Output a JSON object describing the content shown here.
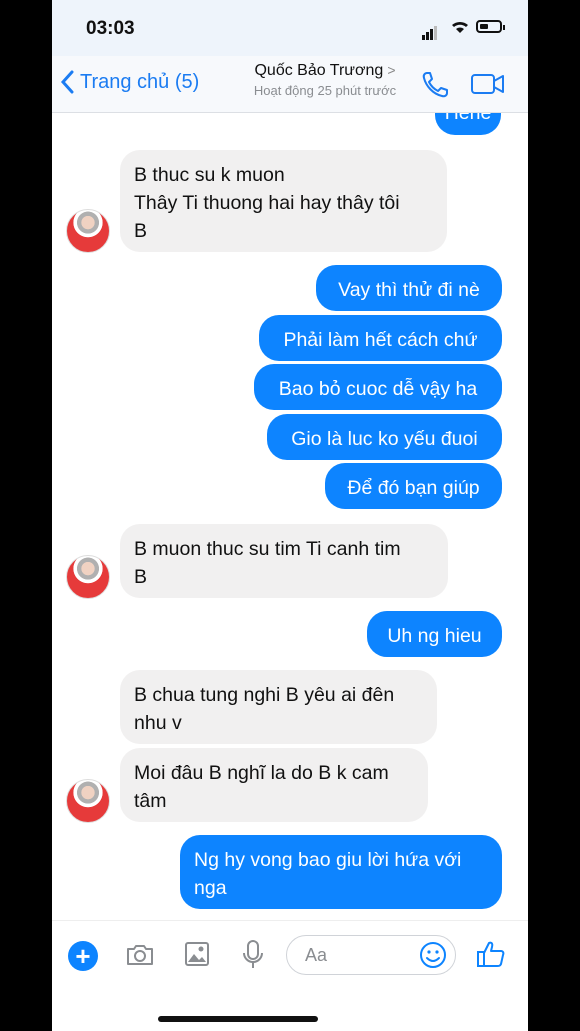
{
  "status_bar": {
    "time": "03:03"
  },
  "header": {
    "back_label": "Trang chủ (5)",
    "contact_name": "Quốc Bảo Trương",
    "contact_status": "Hoạt động 25 phút trước",
    "icons": [
      "chevron-left-icon",
      "phone-icon",
      "video-icon"
    ]
  },
  "messages": [
    {
      "side": "out",
      "text": "Hehe"
    },
    {
      "side": "in",
      "lines": [
        "B thuc su k muon",
        "Thây Ti thuong hai hay thây tôi",
        "B"
      ]
    },
    {
      "side": "out",
      "text": "Vay thì thử đi nè"
    },
    {
      "side": "out",
      "text": "Phải làm hết cách chứ"
    },
    {
      "side": "out",
      "text": "Bao bỏ cuoc dễ vậy ha"
    },
    {
      "side": "out",
      "text": "Gio là luc ko yếu đuoi"
    },
    {
      "side": "out",
      "text": "Để đó bạn giúp"
    },
    {
      "side": "in",
      "lines": [
        "B muon thuc su tim Ti canh tim",
        "B"
      ]
    },
    {
      "side": "out",
      "text": "Uh ng hieu"
    },
    {
      "side": "in",
      "lines": [
        "B chua tung nghi B yêu ai đên",
        "nhu v"
      ]
    },
    {
      "side": "in",
      "lines": [
        "Moi đâu B nghĩ la do B k cam",
        "tâm"
      ]
    },
    {
      "side": "out",
      "lines": [
        "Ng hy vong bao giu lời hứa với",
        "nga"
      ]
    }
  ],
  "composer": {
    "placeholder": "Aa",
    "icons": [
      "plus-icon",
      "camera-icon",
      "image-icon",
      "microphone-icon",
      "smile-icon",
      "thumbs-up-icon"
    ]
  },
  "colors": {
    "accent": "#0d84ff",
    "incoming_bubble": "#f1f0f0",
    "header_bg": "#f7f9fc"
  }
}
